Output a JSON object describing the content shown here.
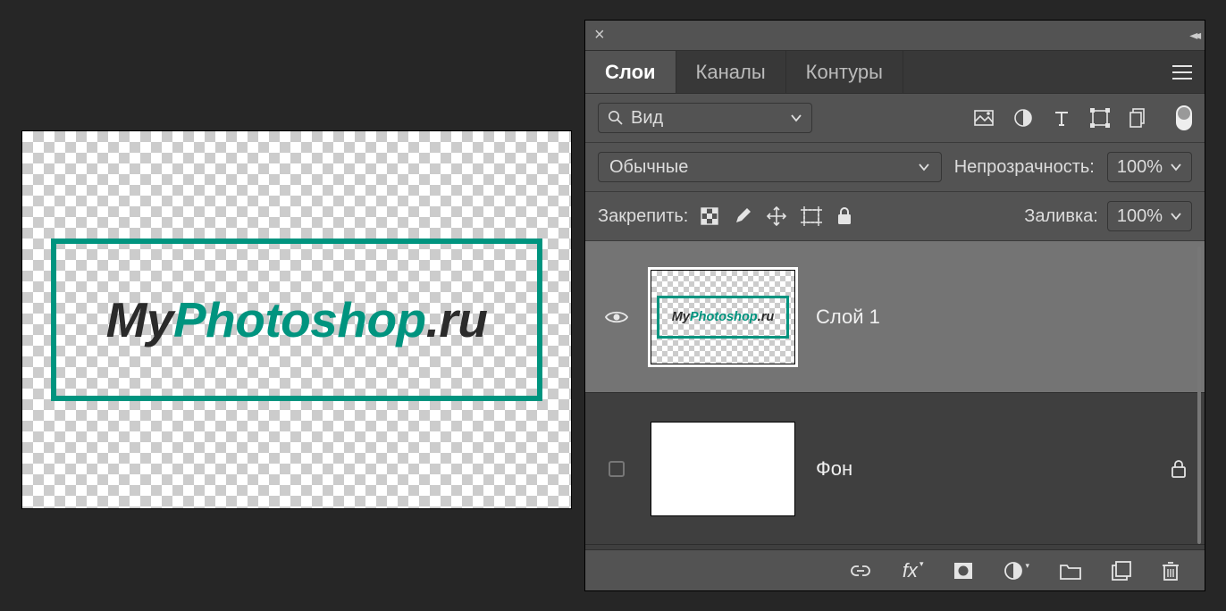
{
  "logo": {
    "part1": "My",
    "part2": "Photoshop",
    "part3": ".ru"
  },
  "panel": {
    "tabs": {
      "layers": "Слои",
      "channels": "Каналы",
      "paths": "Контуры"
    },
    "search_label": "Вид",
    "blend_mode": "Обычные",
    "opacity_label": "Непрозрачность:",
    "opacity_value": "100%",
    "lock_label": "Закрепить:",
    "fill_label": "Заливка:",
    "fill_value": "100%",
    "layers": [
      {
        "name": "Слой 1"
      },
      {
        "name": "Фон"
      }
    ]
  },
  "mini_logo": {
    "part1": "My",
    "part2": "Photoshop",
    "part3": ".ru"
  }
}
